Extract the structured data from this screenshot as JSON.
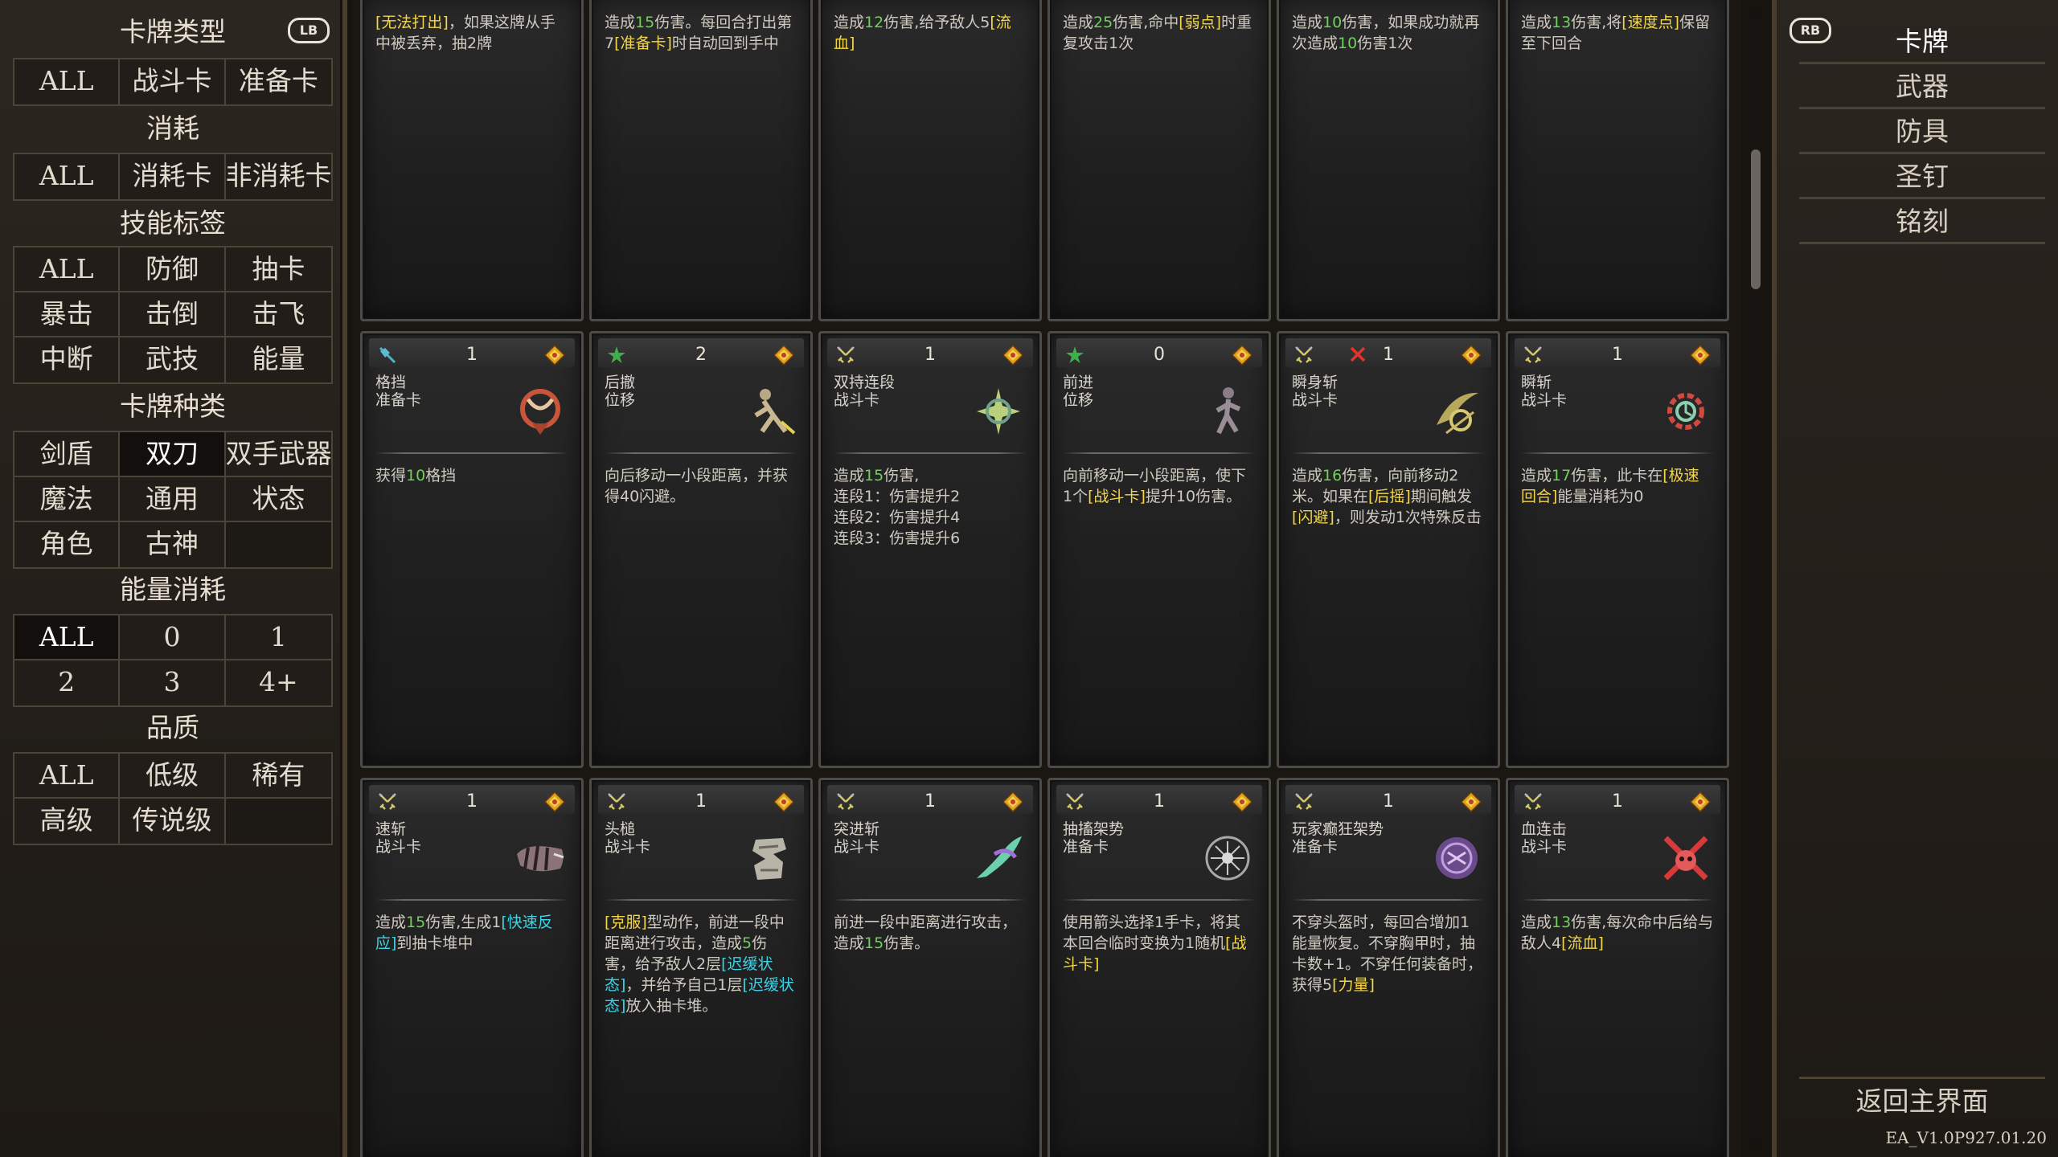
{
  "left_panel": {
    "lb_badge": "LB",
    "sections": {
      "card_type": {
        "title": "卡牌类型",
        "options": [
          "ALL",
          "战斗卡",
          "准备卡"
        ]
      },
      "consume": {
        "title": "消耗",
        "options": [
          "ALL",
          "消耗卡",
          "非消耗卡"
        ]
      },
      "skill_tag": {
        "title": "技能标签",
        "options": [
          "ALL",
          "防御",
          "抽卡",
          "暴击",
          "击倒",
          "击飞",
          "中断",
          "武技",
          "能量"
        ]
      },
      "card_kind": {
        "title": "卡牌种类",
        "options": [
          "剑盾",
          "双刀",
          "双手武器",
          "魔法",
          "通用",
          "状态",
          "角色",
          "古神"
        ],
        "selected": "双刀"
      },
      "energy_cost": {
        "title": "能量消耗",
        "options": [
          "ALL",
          "0",
          "1",
          "2",
          "3",
          "4+"
        ]
      },
      "quality": {
        "title": "品质",
        "options": [
          "ALL",
          "低级",
          "稀有",
          "高级",
          "传说级"
        ]
      }
    }
  },
  "cards_row1": [
    {
      "desc": [
        [
          "y",
          "[无法打出]"
        ],
        [
          "n",
          "，如果这牌从手中被丢弃，抽2牌"
        ]
      ]
    },
    {
      "desc": [
        [
          "n",
          "造成"
        ],
        [
          "g",
          "15"
        ],
        [
          "n",
          "伤害。每回合打出第7"
        ],
        [
          "y",
          "[准备卡]"
        ],
        [
          "n",
          "时自动回到手中"
        ]
      ]
    },
    {
      "desc": [
        [
          "n",
          "造成"
        ],
        [
          "g",
          "12"
        ],
        [
          "n",
          "伤害,给予敌人5"
        ],
        [
          "y",
          "[流血]"
        ]
      ]
    },
    {
      "desc": [
        [
          "n",
          "造成"
        ],
        [
          "g",
          "25"
        ],
        [
          "n",
          "伤害,命中"
        ],
        [
          "y",
          "[弱点]"
        ],
        [
          "n",
          "时重复攻击1次"
        ]
      ]
    },
    {
      "desc": [
        [
          "n",
          "造成"
        ],
        [
          "g",
          "10"
        ],
        [
          "n",
          "伤害，如果成功就再次造成"
        ],
        [
          "g",
          "10"
        ],
        [
          "n",
          "伤害1次"
        ]
      ]
    },
    {
      "desc": [
        [
          "n",
          "造成"
        ],
        [
          "g",
          "13"
        ],
        [
          "n",
          "伤害,将"
        ],
        [
          "y",
          "[速度点]"
        ],
        [
          "n",
          "保留至下回合"
        ]
      ]
    }
  ],
  "cards_row2": [
    {
      "cost": "1",
      "type_icon": "shield-sword-icon",
      "name": "格挡",
      "kind": "准备卡",
      "art": "guard-art-icon",
      "desc": [
        [
          "n",
          "获得"
        ],
        [
          "g",
          "10"
        ],
        [
          "n",
          "格挡"
        ]
      ]
    },
    {
      "cost": "2",
      "type_icon": "green-star-icon",
      "name": "后撤",
      "kind": "位移",
      "art": "retreat-art-icon",
      "desc": [
        [
          "n",
          "向后移动一小段距离，并获得40闪避。"
        ]
      ]
    },
    {
      "cost": "1",
      "type_icon": "crossed-swords-icon",
      "name": "双持连段",
      "kind": "战斗卡",
      "art": "dual-combo-art-icon",
      "desc": [
        [
          "n",
          "造成"
        ],
        [
          "g",
          "15"
        ],
        [
          "n",
          "伤害,\n连段1：伤害提升2\n连段2：伤害提升4\n连段3：伤害提升6"
        ]
      ]
    },
    {
      "cost": "0",
      "type_icon": "green-star-icon",
      "name": "前进",
      "kind": "位移",
      "art": "advance-art-icon",
      "desc": [
        [
          "n",
          "向前移动一小段距离，使下1个"
        ],
        [
          "y",
          "[战斗卡]"
        ],
        [
          "n",
          "提升10伤害。"
        ]
      ]
    },
    {
      "cost": "1",
      "type_icon": "crossed-swords-icon",
      "x_icon": true,
      "name": "瞬身斩",
      "kind": "战斗卡",
      "art": "flash-slash-art-icon",
      "desc": [
        [
          "n",
          "造成"
        ],
        [
          "g",
          "16"
        ],
        [
          "n",
          "伤害，向前移动2米。如果在"
        ],
        [
          "y",
          "[后摇]"
        ],
        [
          "n",
          "期间触发"
        ],
        [
          "y",
          "[闪避]"
        ],
        [
          "n",
          "，则发动1次特殊反击"
        ]
      ]
    },
    {
      "cost": "1",
      "type_icon": "crossed-swords-icon",
      "name": "瞬斩",
      "kind": "战斗卡",
      "art": "instant-slash-art-icon",
      "desc": [
        [
          "n",
          "造成"
        ],
        [
          "g",
          "17"
        ],
        [
          "n",
          "伤害，此卡在"
        ],
        [
          "y",
          "[极速回合]"
        ],
        [
          "n",
          "能量消耗为0"
        ]
      ]
    }
  ],
  "cards_row3": [
    {
      "cost": "1",
      "type_icon": "crossed-swords-icon",
      "name": "速斩",
      "kind": "战斗卡",
      "art": "quick-slash-art-icon",
      "desc": [
        [
          "n",
          "造成"
        ],
        [
          "g",
          "15"
        ],
        [
          "n",
          "伤害,生成1"
        ],
        [
          "c",
          "[快速反应]"
        ],
        [
          "n",
          "到抽卡堆中"
        ]
      ]
    },
    {
      "cost": "1",
      "type_icon": "crossed-swords-icon",
      "name": "头槌",
      "kind": "战斗卡",
      "art": "headbutt-art-icon",
      "desc": [
        [
          "y",
          "[克服]"
        ],
        [
          "n",
          "型动作，前进一段中距离进行攻击，造成"
        ],
        [
          "g",
          "5"
        ],
        [
          "n",
          "伤害，给予敌人2层"
        ],
        [
          "c",
          "[迟缓状态]"
        ],
        [
          "n",
          "，并给予自己1层"
        ],
        [
          "c",
          "[迟缓状态]"
        ],
        [
          "n",
          "放入抽卡堆。"
        ]
      ]
    },
    {
      "cost": "1",
      "type_icon": "crossed-swords-icon",
      "name": "突进斩",
      "kind": "战斗卡",
      "art": "dash-slash-art-icon",
      "desc": [
        [
          "n",
          "前进一段中距离进行攻击，造成"
        ],
        [
          "g",
          "15"
        ],
        [
          "n",
          "伤害。"
        ]
      ]
    },
    {
      "cost": "1",
      "type_icon": "crossed-swords-icon",
      "name": "抽搐架势",
      "kind": "准备卡",
      "art": "spasm-stance-art-icon",
      "desc": [
        [
          "n",
          "使用箭头选择1手卡，将其本回合临时变换为1随机"
        ],
        [
          "y",
          "[战斗卡]"
        ]
      ]
    },
    {
      "cost": "1",
      "type_icon": "crossed-swords-icon",
      "name": "玩家癫狂架势",
      "kind": "准备卡",
      "art": "frenzy-stance-art-icon",
      "desc": [
        [
          "n",
          "不穿头盔时，每回合增加1能量恢复。不穿胸甲时，抽卡数+1。不穿任何装备时，获得5"
        ],
        [
          "y",
          "[力量]"
        ]
      ]
    },
    {
      "cost": "1",
      "type_icon": "crossed-swords-icon",
      "name": "血连击",
      "kind": "战斗卡",
      "art": "blood-combo-art-icon",
      "desc": [
        [
          "n",
          "造成"
        ],
        [
          "g",
          "13"
        ],
        [
          "n",
          "伤害,每次命中后给与敌人4"
        ],
        [
          "y",
          "[流血]"
        ]
      ]
    }
  ],
  "right_panel": {
    "rb_badge": "RB",
    "nav": [
      "卡牌",
      "武器",
      "防具",
      "圣钉",
      "铭刻"
    ],
    "active": "卡牌",
    "return_label": "返回主界面",
    "version": "EA_V1.0P927.01.20"
  },
  "colors": {
    "highlight_green": "#6fd05a",
    "highlight_yellow": "#f4d64a",
    "highlight_cyan": "#3fd3e8"
  }
}
